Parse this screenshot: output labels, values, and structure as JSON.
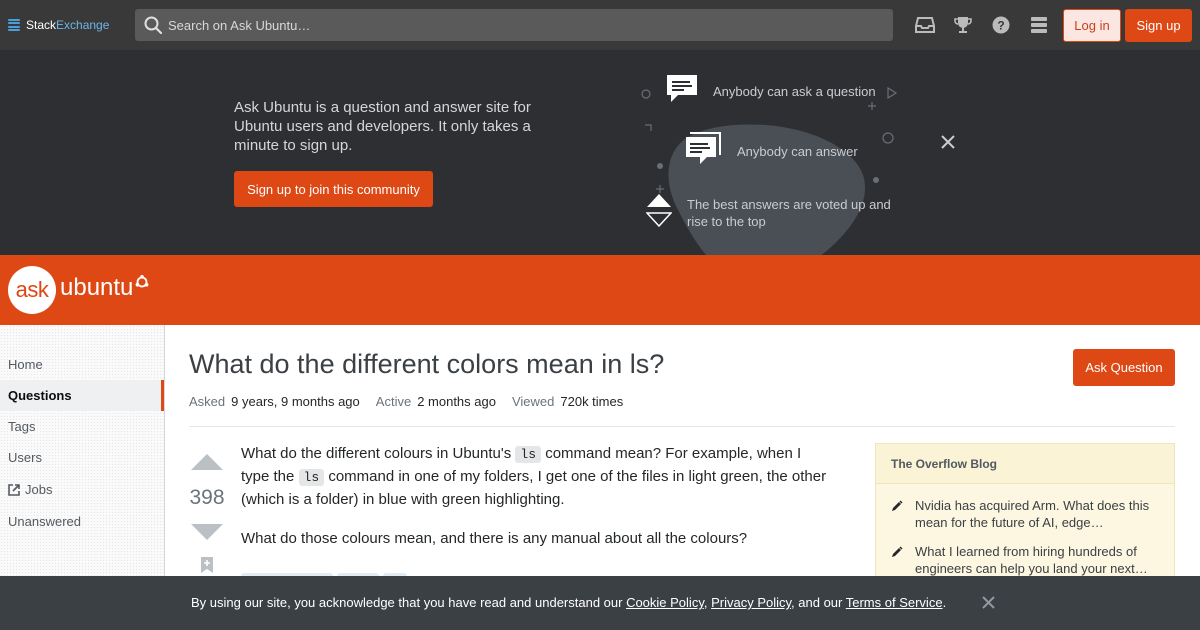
{
  "topbar": {
    "logo_part1": "Stack",
    "logo_part2": "Exchange",
    "search_placeholder": "Search on Ask Ubuntu…",
    "icons": [
      "inbox-icon",
      "achievements-icon",
      "help-icon",
      "site-switcher-icon"
    ],
    "login_label": "Log in",
    "signup_label": "Sign up"
  },
  "hero": {
    "text": "Ask Ubuntu is a question and answer site for Ubuntu users and developers. It only takes a minute to sign up.",
    "cta": "Sign up to join this community",
    "item1": "Anybody can ask a question",
    "item2": "Anybody can answer",
    "item3": "The best answers are voted up and rise to the top"
  },
  "banner": {
    "logo_bubble": "ask",
    "logo_word": "ubuntu"
  },
  "sidebar": {
    "items": [
      {
        "label": "Home"
      },
      {
        "label": "Questions"
      },
      {
        "label": "Tags"
      },
      {
        "label": "Users"
      },
      {
        "label": "Jobs"
      },
      {
        "label": "Unanswered"
      }
    ],
    "active": "Questions"
  },
  "question": {
    "title": "What do the different colors mean in ls?",
    "ask_button": "Ask Question",
    "asked_label": "Asked",
    "asked_value": "9 years, 9 months ago",
    "active_label": "Active",
    "active_value": "2 months ago",
    "viewed_label": "Viewed",
    "viewed_value": "720k times",
    "votes": "398",
    "body_p1_a": "What do the different colours in Ubuntu's ",
    "body_p1_code1": "ls",
    "body_p1_b": " command mean? For example, when I type the ",
    "body_p1_code2": "ls",
    "body_p1_c": " command in one of my folders, I get one of the files in light green, the other (which is a folder) in blue with green highlighting.",
    "body_p2": "What do those colours mean, and there is any manual about all the colours?"
  },
  "blog": {
    "heading": "The Overflow Blog",
    "items": [
      "Nvidia has acquired Arm. What does this mean for the future of AI, edge…",
      "What I learned from hiring hundreds of engineers can help you land your next…"
    ]
  },
  "cookie": {
    "pre": "By using our site, you acknowledge that you have read and understand our ",
    "link1": "Cookie Policy",
    "sep1": ", ",
    "link2": "Privacy Policy",
    "sep2": ", and our ",
    "link3": "Terms of Service",
    "post": "."
  },
  "colors": {
    "brand": "#dd4814",
    "topbar": "#393939",
    "hero": "#2d2f33",
    "cookie_bar": "#3b4045"
  }
}
